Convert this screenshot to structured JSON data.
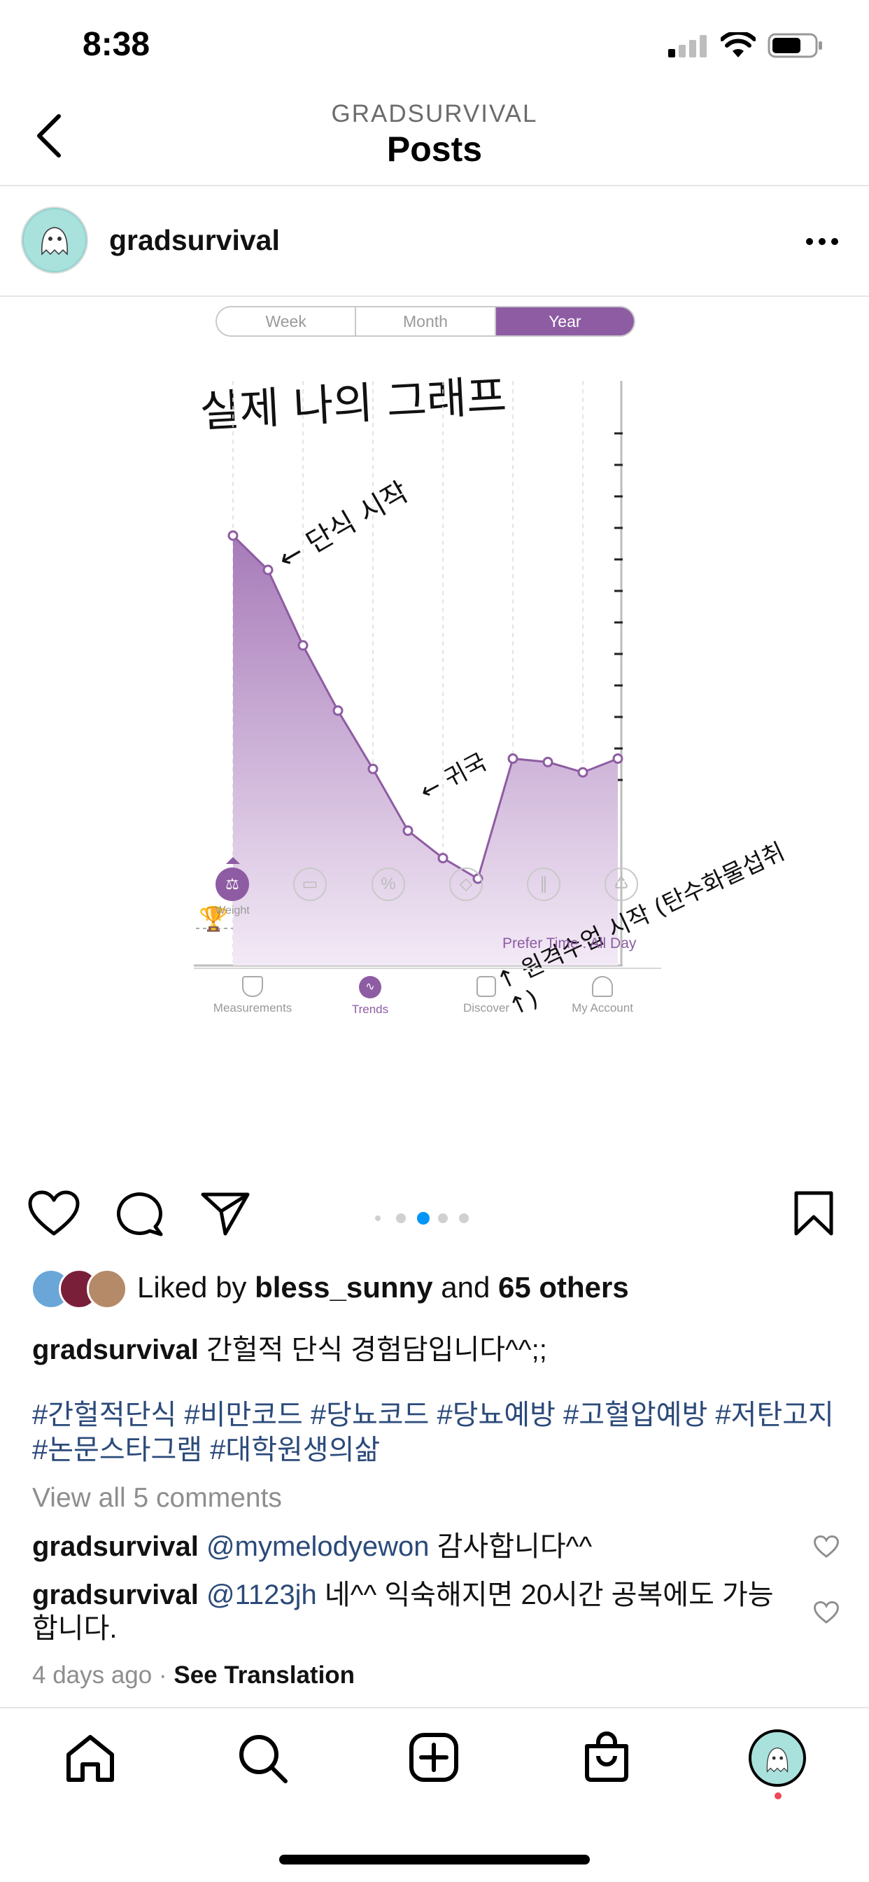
{
  "status_bar": {
    "time": "8:38"
  },
  "header": {
    "account_label": "GRADSURVIVAL",
    "title": "Posts"
  },
  "post": {
    "username": "gradsurvival",
    "image": {
      "segments": [
        "Week",
        "Month",
        "Year"
      ],
      "selected_segment": "Year",
      "handwritten_title": "실제 나의 그래프",
      "annotation_start": "← 단식 시작",
      "annotation_back": "← 귀국",
      "annotation_resist": "↑ 원격수업 시작 (탄수화물섭취↑)",
      "metric_label": "Weight",
      "prefer_time": "Prefer Time : All Day",
      "nav": [
        "Measurements",
        "Trends",
        "Discover",
        "My Account"
      ],
      "accent_color": "#8e5ca3"
    },
    "carousel": {
      "total": 5,
      "active": 3
    },
    "likes": {
      "prefix": "Liked by ",
      "user": "bless_sunny",
      "middle": " and ",
      "others": "65 others"
    },
    "caption": {
      "user": "gradsurvival",
      "text": "간헐적 단식 경험담입니다^^;;"
    },
    "hashtags": "#간헐적단식 #비만코드 #당뇨코드 #당뇨예방 #고혈압예방 #저탄고지 #논문스타그램 #대학원생의삶",
    "view_comments": "View all 5 comments",
    "comments": [
      {
        "user": "gradsurvival",
        "mention": "@mymelodyewon",
        "text": " 감사합니다^^"
      },
      {
        "user": "gradsurvival",
        "mention": "@1123jh",
        "text": " 네^^ 익숙해지면 20시간 공복에도 가능합니다."
      }
    ],
    "time_ago": "4 days ago",
    "see_translation": "See Translation"
  },
  "chart_data": {
    "type": "area",
    "x": [
      1,
      2,
      3,
      4,
      5,
      6,
      7,
      8,
      9,
      10,
      11,
      12
    ],
    "series": [
      {
        "values": [
          100,
          90,
          68,
          49,
          32,
          14,
          6,
          0,
          35,
          34,
          31,
          35
        ]
      }
    ]
  }
}
